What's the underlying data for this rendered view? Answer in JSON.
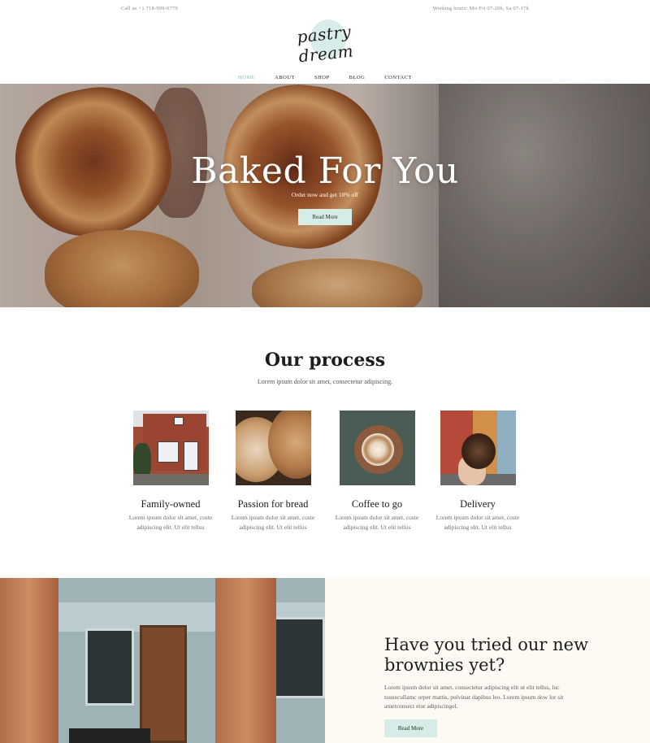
{
  "topbar": {
    "phone": "Call us +1 718-999-0779",
    "hours": "Working hours: Mo-Fri 07-20h, Sa 07-17h"
  },
  "logo": {
    "text": "pastry dream"
  },
  "nav": {
    "items": [
      {
        "label": "HOME",
        "active": true
      },
      {
        "label": "ABOUT",
        "active": false
      },
      {
        "label": "SHOP",
        "active": false
      },
      {
        "label": "BLOG",
        "active": false
      },
      {
        "label": "CONTACT",
        "active": false
      }
    ]
  },
  "hero": {
    "title": "Baked For You",
    "subtitle": "Order now and get 10% off",
    "button": "Read More"
  },
  "process": {
    "title": "Our process",
    "subtitle": "Lorem ipsum dolor sit amet, consectetur adipiscing.",
    "cards": [
      {
        "title": "Family-owned",
        "text": "Lorem ipsum dolor sit amet, coste adipiscing elit. Ut elit tellus",
        "image": "brick-house-storefront"
      },
      {
        "title": "Passion for bread",
        "text": "Lorem ipsum dolor sit amet, coste adipiscing elit. Ut elit tellus",
        "image": "bread-loaves"
      },
      {
        "title": "Coffee to go",
        "text": "Lorem ipsum dolor sit amet, coste adipiscing elit. Ut elit tellus",
        "image": "coffee-cup-in-hands"
      },
      {
        "title": "Delivery",
        "text": "Lorem ipsum dolor sit amet, coste adipiscing elit. Ut elit tellus",
        "image": "donut-in-hand-street"
      }
    ]
  },
  "feature": {
    "title": "Have you tried our new brownies yet?",
    "text": "Lorem ipsum dolor sit amet, consectetur adipiscing elit ut elit tellus, luc tusnecullamc orper mattis, pulvinar dapibus leo. Lorem ipsum dow lor sit ametconsect etur adipiscingel.",
    "button": "Read More",
    "image": "bakery-storefront-brick-pillars"
  },
  "colors": {
    "accent_mint": "#d6ece7",
    "nav_active": "#8fc2bb",
    "feature_bg": "#fdf9f3",
    "text_dark": "#1d1d1d"
  }
}
